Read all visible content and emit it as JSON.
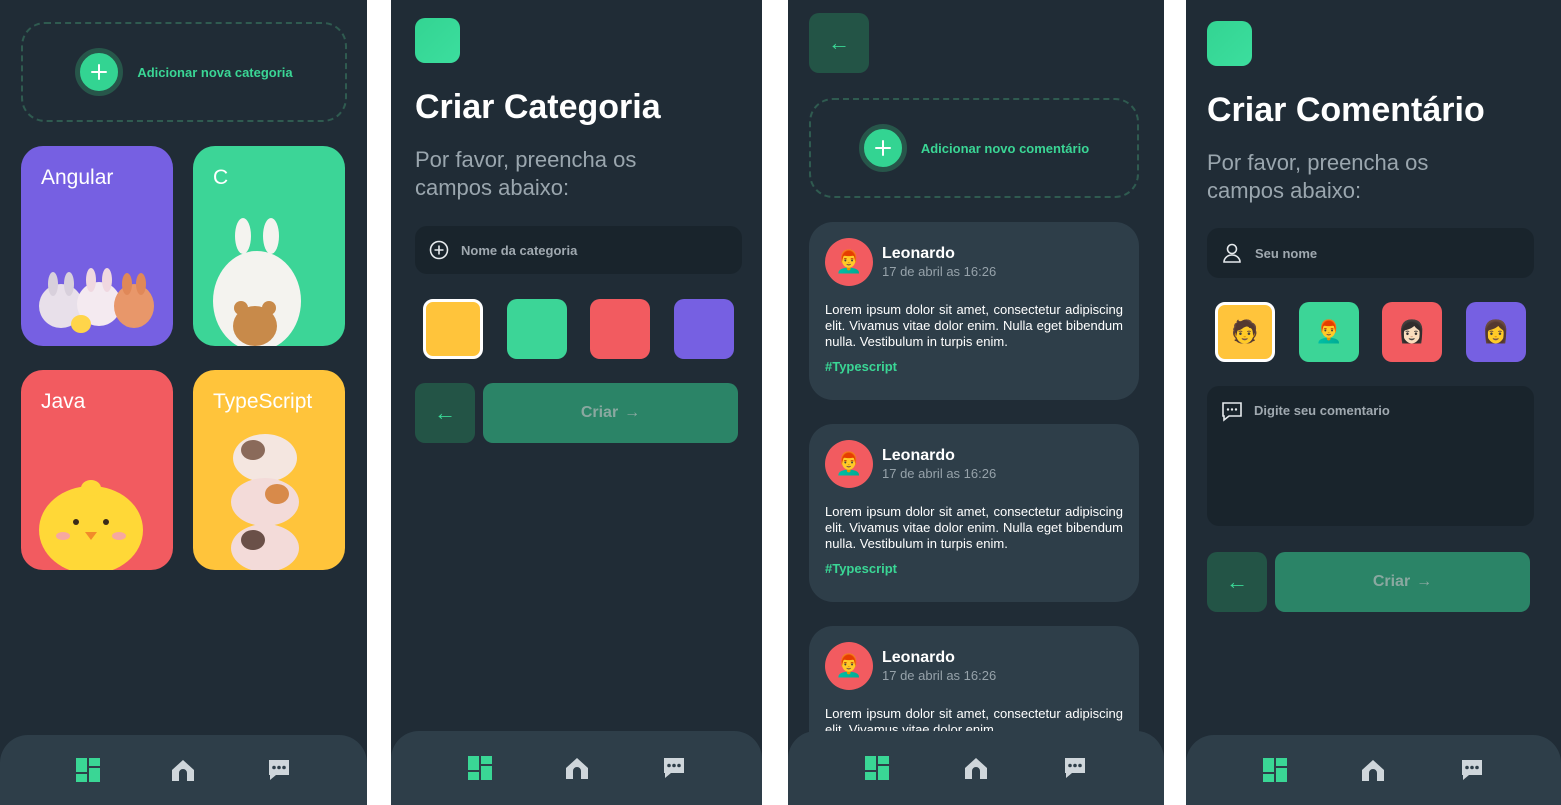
{
  "colors": {
    "bg": "#202c36",
    "panel": "#2e3e49",
    "accent": "#3ad695",
    "yellow": "#ffc43b",
    "green": "#3cd597",
    "red": "#f25b60",
    "purple": "#7660e2"
  },
  "categories_screen": {
    "add_label": "Adicionar nova categoria",
    "cards": [
      {
        "title": "Angular",
        "color": "#7660e2"
      },
      {
        "title": "C",
        "color": "#3cd597"
      },
      {
        "title": "Java",
        "color": "#f25b60"
      },
      {
        "title": "TypeScript",
        "color": "#ffc43b"
      }
    ]
  },
  "create_category": {
    "title": "Criar Categoria",
    "subtitle": "Por favor, preencha os campos abaixo:",
    "input_placeholder": "Nome da categoria",
    "color_options": [
      "#ffc43b",
      "#3cd597",
      "#f25b60",
      "#7660e2"
    ],
    "selected_index": 0,
    "back_label": "←",
    "create_label": "Criar",
    "create_arrow": "→"
  },
  "comments_screen": {
    "back_label": "←",
    "add_label": "Adicionar novo comentário",
    "comments": [
      {
        "name": "Leonardo",
        "date": "17 de abril as 16:26",
        "text": "Lorem ipsum dolor sit amet, consectetur adipiscing elit. Vivamus vitae dolor enim. Nulla eget bibendum nulla. Vestibulum in turpis enim.",
        "tag": "#Typescript",
        "avatar": "👨‍🦰"
      },
      {
        "name": "Leonardo",
        "date": "17 de abril as 16:26",
        "text": "Lorem ipsum dolor sit amet, consectetur adipiscing elit. Vivamus vitae dolor enim. Nulla eget bibendum nulla. Vestibulum in turpis enim.",
        "tag": "#Typescript",
        "avatar": "👨‍🦰"
      },
      {
        "name": "Leonardo",
        "date": "17 de abril as 16:26",
        "text": "Lorem ipsum dolor sit amet, consectetur adipiscing elit. Vivamus vitae dolor enim.",
        "tag": "",
        "avatar": "👨‍🦰"
      }
    ]
  },
  "create_comment": {
    "title": "Criar Comentário",
    "subtitle": "Por favor, preencha os campos abaixo:",
    "name_placeholder": "Seu nome",
    "avatar_options": [
      {
        "emoji": "🧑",
        "color": "#ffc43b"
      },
      {
        "emoji": "👨‍🦰",
        "color": "#3cd597"
      },
      {
        "emoji": "👩🏻",
        "color": "#f25b60"
      },
      {
        "emoji": "👩",
        "color": "#7660e2"
      }
    ],
    "comment_placeholder": "Digite seu comentario",
    "back_label": "←",
    "create_label": "Criar",
    "create_arrow": "→"
  },
  "nav": {
    "icons": [
      "dashboard-icon",
      "home-icon",
      "chat-icon"
    ]
  }
}
